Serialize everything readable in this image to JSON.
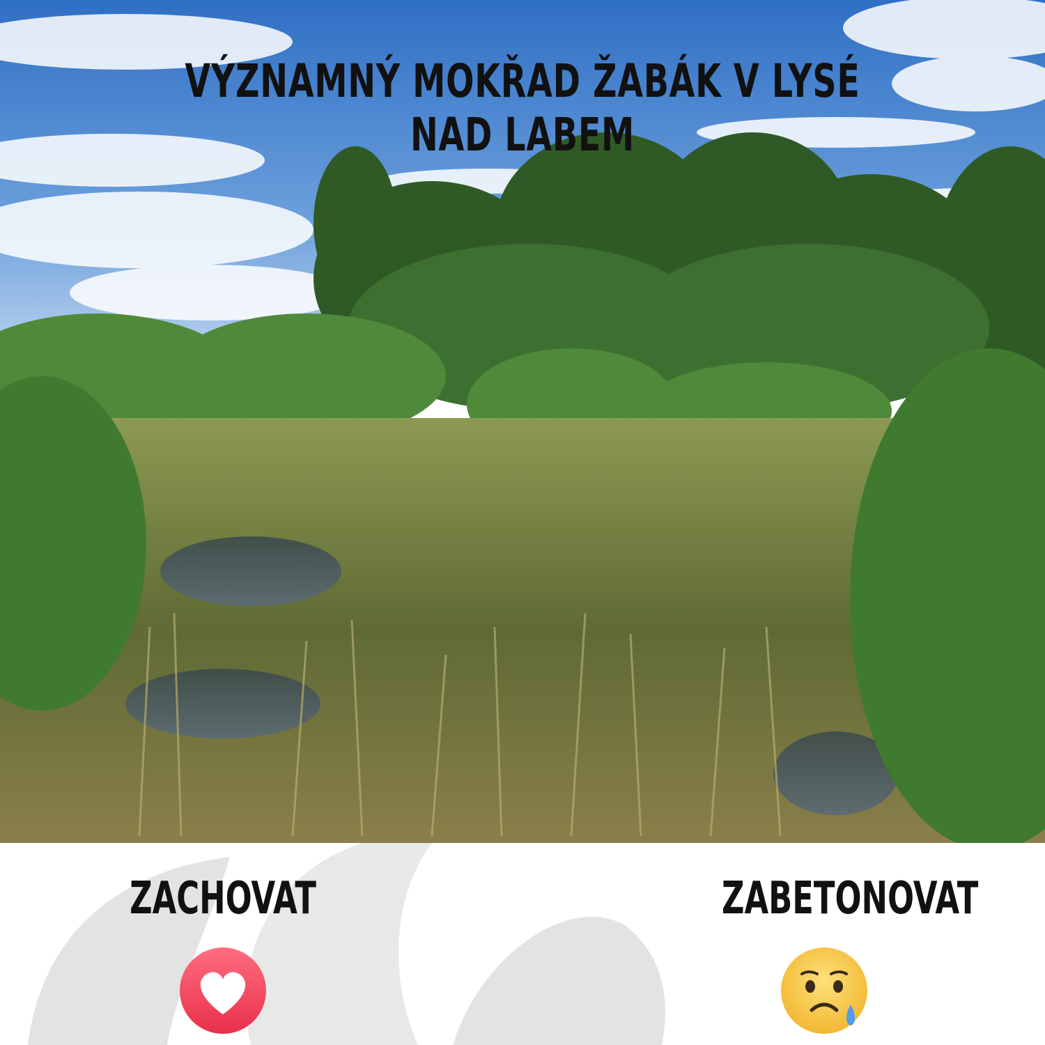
{
  "title": "VÝZNAMNÝ MOKŘAD ŽABÁK V LYSÉ NAD LABEM",
  "options": [
    {
      "label": "ZACHOVAT",
      "icon": "heart-reaction-icon",
      "color": "#f0475f"
    },
    {
      "label": "ZABETONOVAT",
      "icon": "sad-reaction-icon",
      "color": "#f7c640"
    }
  ],
  "colors": {
    "sky": "#3a78c9",
    "text": "#111111",
    "watermark": "#e0e0e0"
  }
}
